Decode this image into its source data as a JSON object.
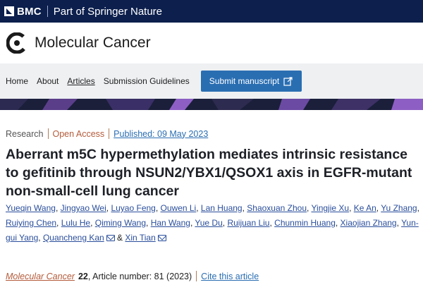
{
  "brand": {
    "bmc": "BMC",
    "publisher": "Part of Springer Nature",
    "bg_color": "#0c1f4d"
  },
  "journal": {
    "title": "Molecular Cancer",
    "logo_icon": "molecular-cancer-logo"
  },
  "nav": {
    "items": [
      {
        "label": "Home"
      },
      {
        "label": "About"
      },
      {
        "label": "Articles"
      },
      {
        "label": "Submission Guidelines"
      }
    ],
    "submit_label": "Submit manuscript",
    "submit_icon": "external-link-icon",
    "button_color": "#2a6eb2"
  },
  "article": {
    "type": "Research",
    "access": "Open Access",
    "published": "Published: 09 May 2023",
    "title": "Aberrant m5C hypermethylation mediates intrinsic resistance to gefitinib through NSUN2/YBX1/QSOX1 axis in EGFR-mutant non-small-cell lung cancer",
    "authors": {
      "a1": "Yueqin Wang",
      "a2": "Jingyao Wei",
      "a3": "Luyao Feng",
      "a4": "Ouwen Li",
      "a5": "Lan Huang",
      "a6": "Shaoxuan Zhou",
      "a7": "Yingjie Xu",
      "a8": "Ke An",
      "a9": "Yu Zhang",
      "a10": "Ruiying Chen",
      "a11": "Lulu He",
      "a12": "Qiming Wang",
      "a13": "Han Wang",
      "a14": "Yue Du",
      "a15": "Ruijuan Liu",
      "a16": "Chunmin Huang",
      "a17": "Xiaojian Zhang",
      "a18": "Yun-gui Yang",
      "a19": "Quancheng Kan",
      "a20": "Xin Tian"
    },
    "and": "&",
    "citation": {
      "journal": "Molecular Cancer",
      "volume": "22",
      "rest": ", Article number: 81 (2023)",
      "cite_label": "Cite this article"
    }
  }
}
